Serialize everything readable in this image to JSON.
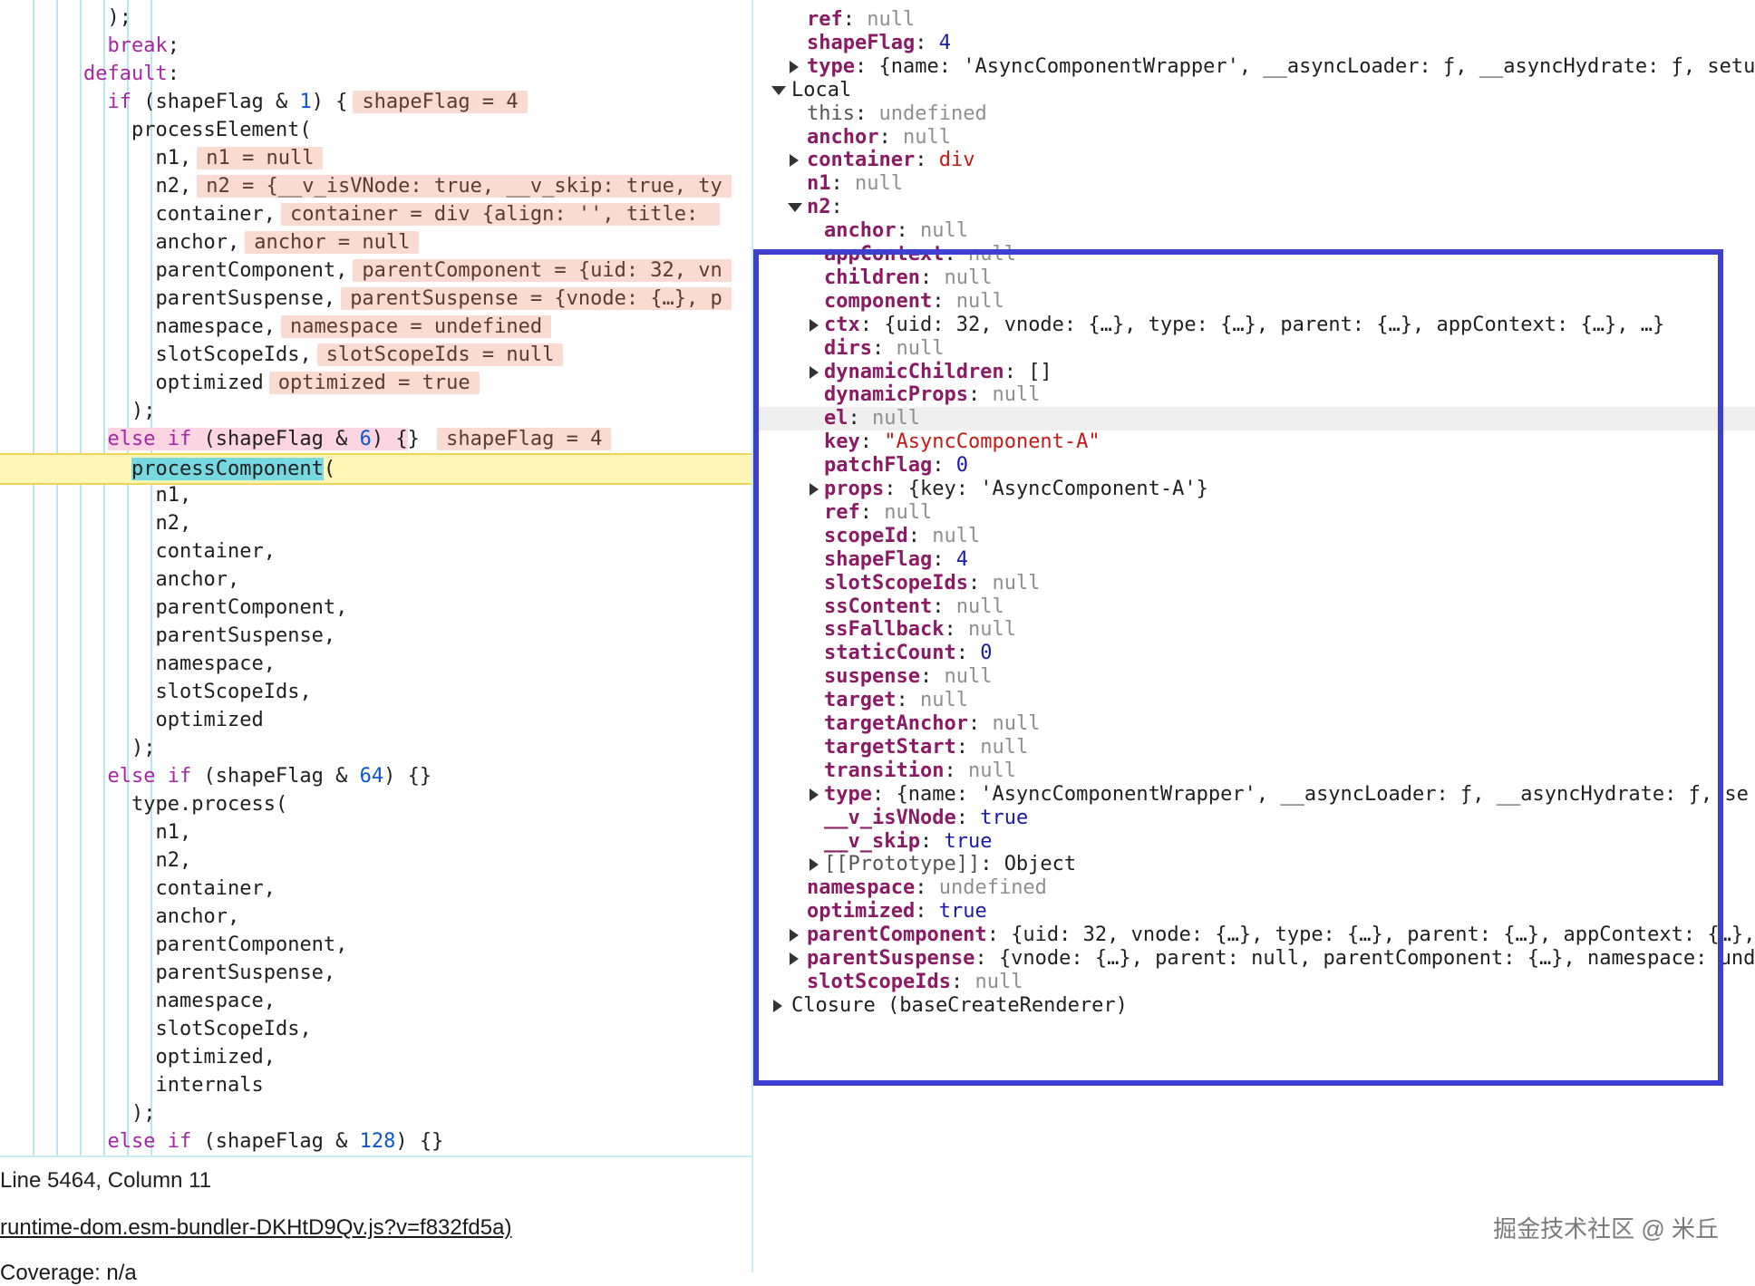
{
  "editor": {
    "code_lines": [
      {
        "indent": 6,
        "text": ");"
      },
      {
        "indent": 6,
        "kw": "break",
        "text": ";"
      },
      {
        "indent": 4,
        "kw": "default",
        "text": ":"
      },
      {
        "indent": 6,
        "kw": "if",
        "text": " (shapeFlag & ",
        "num": "1",
        "tail": ") {",
        "badge": "shapeFlag = 4"
      },
      {
        "indent": 8,
        "text": "processElement("
      },
      {
        "indent": 10,
        "text": "n1,",
        "badge": "n1 = null"
      },
      {
        "indent": 10,
        "text": "n2,",
        "badge": "n2 = {__v_isVNode: true, __v_skip: true, ty"
      },
      {
        "indent": 10,
        "text": "container,",
        "badge": "container = div {align: '', title: "
      },
      {
        "indent": 10,
        "text": "anchor,",
        "badge": "anchor = null"
      },
      {
        "indent": 10,
        "text": "parentComponent,",
        "badge": "parentComponent = {uid: 32, vn"
      },
      {
        "indent": 10,
        "text": "parentSuspense,",
        "badge": "parentSuspense = {vnode: {…}, p"
      },
      {
        "indent": 10,
        "text": "namespace,",
        "badge": "namespace = undefined"
      },
      {
        "indent": 10,
        "text": "slotScopeIds,",
        "badge": "slotScopeIds = null"
      },
      {
        "indent": 10,
        "text": "optimized",
        "badge": "optimized = true"
      },
      {
        "indent": 8,
        "text": ");"
      },
      {
        "indent": 6,
        "text": "} ",
        "kw": "else if",
        "text2": " (shapeFlag & ",
        "num": "6",
        "tail": ") {",
        "badge": "shapeFlag = 4",
        "pink": true
      },
      {
        "indent": 8,
        "text": "(",
        "hlword": "processComponent",
        "current": true
      },
      {
        "indent": 10,
        "text": "n1,"
      },
      {
        "indent": 10,
        "text": "n2,"
      },
      {
        "indent": 10,
        "text": "container,"
      },
      {
        "indent": 10,
        "text": "anchor,"
      },
      {
        "indent": 10,
        "text": "parentComponent,"
      },
      {
        "indent": 10,
        "text": "parentSuspense,"
      },
      {
        "indent": 10,
        "text": "namespace,"
      },
      {
        "indent": 10,
        "text": "slotScopeIds,"
      },
      {
        "indent": 10,
        "text": "optimized"
      },
      {
        "indent": 8,
        "text": ");"
      },
      {
        "indent": 6,
        "text": "} ",
        "kw": "else if",
        "text2": " (shapeFlag & ",
        "num": "64",
        "tail": ") {"
      },
      {
        "indent": 8,
        "text": "type.process("
      },
      {
        "indent": 10,
        "text": "n1,"
      },
      {
        "indent": 10,
        "text": "n2,"
      },
      {
        "indent": 10,
        "text": "container,"
      },
      {
        "indent": 10,
        "text": "anchor,"
      },
      {
        "indent": 10,
        "text": "parentComponent,"
      },
      {
        "indent": 10,
        "text": "parentSuspense,"
      },
      {
        "indent": 10,
        "text": "namespace,"
      },
      {
        "indent": 10,
        "text": "slotScopeIds,"
      },
      {
        "indent": 10,
        "text": "optimized,"
      },
      {
        "indent": 10,
        "text": "internals"
      },
      {
        "indent": 8,
        "text": ");"
      },
      {
        "indent": 6,
        "text": "} ",
        "kw": "else if",
        "text2": " (shapeFlag & ",
        "num": "128",
        "tail": ") {"
      }
    ],
    "status": {
      "position": "Line 5464, Column 11",
      "file": "runtime-dom.esm-bundler-DKHtD9Qv.js?v=f832fd5a)",
      "coverage": "Coverage: n/a"
    }
  },
  "scope": {
    "rows": [
      {
        "depth": 1,
        "key": "ref",
        "value": "null",
        "vt": "null"
      },
      {
        "depth": 1,
        "key": "shapeFlag",
        "value": "4",
        "vt": "num"
      },
      {
        "depth": 1,
        "key": "type",
        "value": "{name: 'AsyncComponentWrapper', __asyncLoader: ƒ, __asyncHydrate: ƒ, setu",
        "vt": "obj",
        "expander": "closed"
      },
      {
        "depth": 0,
        "section": "Local",
        "expander": "open"
      },
      {
        "depth": 1,
        "key": "this",
        "value": "undefined",
        "vt": "null",
        "plainkey": true
      },
      {
        "depth": 1,
        "key": "anchor",
        "value": "null",
        "vt": "null"
      },
      {
        "depth": 1,
        "key": "container",
        "value": "div",
        "vt": "str",
        "expander": "closed"
      },
      {
        "depth": 1,
        "key": "n1",
        "value": "null",
        "vt": "null"
      },
      {
        "depth": 1,
        "key": "n2",
        "value": "",
        "vt": "obj",
        "expander": "open"
      },
      {
        "depth": 2,
        "key": "anchor",
        "value": "null",
        "vt": "null"
      },
      {
        "depth": 2,
        "key": "appContext",
        "value": "null",
        "vt": "null"
      },
      {
        "depth": 2,
        "key": "children",
        "value": "null",
        "vt": "null"
      },
      {
        "depth": 2,
        "key": "component",
        "value": "null",
        "vt": "null"
      },
      {
        "depth": 2,
        "key": "ctx",
        "value": "{uid: 32, vnode: {…}, type: {…}, parent: {…}, appContext: {…}, …}",
        "vt": "obj",
        "expander": "closed"
      },
      {
        "depth": 2,
        "key": "dirs",
        "value": "null",
        "vt": "null"
      },
      {
        "depth": 2,
        "key": "dynamicChildren",
        "value": "[]",
        "vt": "obj",
        "expander": "closed"
      },
      {
        "depth": 2,
        "key": "dynamicProps",
        "value": "null",
        "vt": "null"
      },
      {
        "depth": 2,
        "key": "el",
        "value": "null",
        "vt": "null",
        "hover": true
      },
      {
        "depth": 2,
        "key": "key",
        "value": "\"AsyncComponent-A\"",
        "vt": "str"
      },
      {
        "depth": 2,
        "key": "patchFlag",
        "value": "0",
        "vt": "num"
      },
      {
        "depth": 2,
        "key": "props",
        "value": "{key: 'AsyncComponent-A'}",
        "vt": "obj",
        "expander": "closed"
      },
      {
        "depth": 2,
        "key": "ref",
        "value": "null",
        "vt": "null"
      },
      {
        "depth": 2,
        "key": "scopeId",
        "value": "null",
        "vt": "null"
      },
      {
        "depth": 2,
        "key": "shapeFlag",
        "value": "4",
        "vt": "num"
      },
      {
        "depth": 2,
        "key": "slotScopeIds",
        "value": "null",
        "vt": "null"
      },
      {
        "depth": 2,
        "key": "ssContent",
        "value": "null",
        "vt": "null"
      },
      {
        "depth": 2,
        "key": "ssFallback",
        "value": "null",
        "vt": "null"
      },
      {
        "depth": 2,
        "key": "staticCount",
        "value": "0",
        "vt": "num"
      },
      {
        "depth": 2,
        "key": "suspense",
        "value": "null",
        "vt": "null"
      },
      {
        "depth": 2,
        "key": "target",
        "value": "null",
        "vt": "null"
      },
      {
        "depth": 2,
        "key": "targetAnchor",
        "value": "null",
        "vt": "null"
      },
      {
        "depth": 2,
        "key": "targetStart",
        "value": "null",
        "vt": "null"
      },
      {
        "depth": 2,
        "key": "transition",
        "value": "null",
        "vt": "null"
      },
      {
        "depth": 2,
        "key": "type",
        "value": "{name: 'AsyncComponentWrapper', __asyncLoader: ƒ, __asyncHydrate: ƒ, se",
        "vt": "obj",
        "expander": "closed"
      },
      {
        "depth": 2,
        "key": "__v_isVNode",
        "value": "true",
        "vt": "bool"
      },
      {
        "depth": 2,
        "key": "__v_skip",
        "value": "true",
        "vt": "bool"
      },
      {
        "depth": 2,
        "key": "[[Prototype]]",
        "value": "Object",
        "vt": "obj",
        "expander": "closed",
        "plainkey": true
      },
      {
        "depth": 1,
        "key": "namespace",
        "value": "undefined",
        "vt": "null"
      },
      {
        "depth": 1,
        "key": "optimized",
        "value": "true",
        "vt": "bool"
      },
      {
        "depth": 1,
        "key": "parentComponent",
        "value": "{uid: 32, vnode: {…}, type: {…}, parent: {…}, appContext: {…},…",
        "vt": "obj",
        "expander": "closed"
      },
      {
        "depth": 1,
        "key": "parentSuspense",
        "value": "{vnode: {…}, parent: null, parentComponent: {…}, namespace: und",
        "vt": "obj",
        "expander": "closed"
      },
      {
        "depth": 1,
        "key": "slotScopeIds",
        "value": "null",
        "vt": "null"
      },
      {
        "depth": 0,
        "section": "Closure (baseCreateRenderer)",
        "expander": "closed"
      }
    ]
  },
  "watermark": "掘金技术社区 @ 米丘"
}
